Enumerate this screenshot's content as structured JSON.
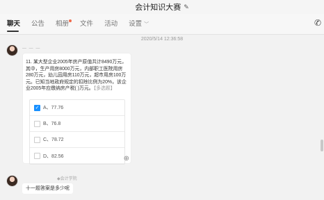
{
  "window": {
    "title": "会计知识大赛"
  },
  "tabs": [
    {
      "label": "聊天",
      "active": true
    },
    {
      "label": "公告"
    },
    {
      "label": "相册",
      "badge_dot": true
    },
    {
      "label": "文件"
    },
    {
      "label": "活动"
    },
    {
      "label": "设置"
    }
  ],
  "chat": {
    "timestamp": "2020/5/14 12:36:58",
    "sender_name": "— — —",
    "question": {
      "text": "11. 某大型企业2005年房产原值共计8490万元，其中，生产用房8000万元，内部职工医院用房280万元，幼儿园用房110万元，超市用房100万元。已知当地政府规定的扣除比例为20%，该企业2005年应缴纳房产税( )万元。",
      "tag": "【多选题】",
      "options": [
        {
          "label": "A、77.76",
          "checked": true
        },
        {
          "label": "B、76.8",
          "checked": false
        },
        {
          "label": "C、78.72",
          "checked": false
        },
        {
          "label": "D、82.56",
          "checked": false
        }
      ]
    },
    "source_label": "会计学院",
    "reply": "十一题答案是多少呢"
  },
  "colors": {
    "accent": "#1890ff",
    "badge": "#f06a4a"
  }
}
